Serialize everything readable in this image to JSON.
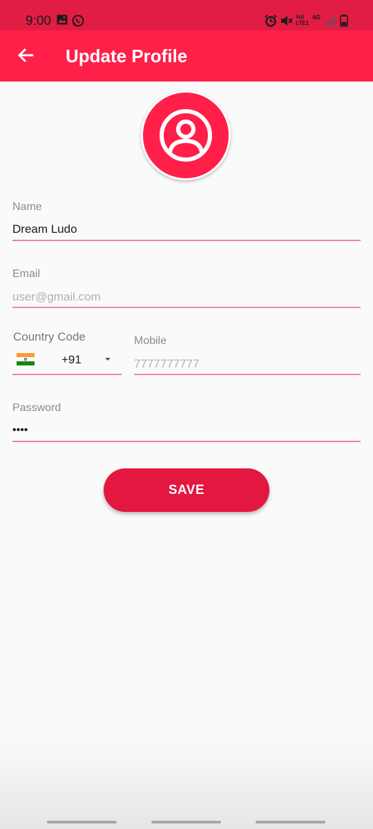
{
  "status_bar": {
    "time": "9:00",
    "icons": [
      "gallery-icon",
      "whatsapp-icon",
      "alarm-icon",
      "mute-icon",
      "volte-icon",
      "4g-icon",
      "signal-icon",
      "battery-icon"
    ],
    "volte_label": "Vo) LTE1",
    "network_label": "4G"
  },
  "app_bar": {
    "title": "Update Profile",
    "back_icon": "arrow-left-icon"
  },
  "avatar": {
    "icon": "user-circle-icon"
  },
  "form": {
    "name": {
      "label": "Name",
      "value": "Dream Ludo"
    },
    "email": {
      "label": "Email",
      "placeholder": "user@gmail.com"
    },
    "country_code": {
      "label": "Country Code",
      "value": "+91",
      "flag": "india-flag-icon"
    },
    "mobile": {
      "label": "Mobile",
      "placeholder": "7777777777"
    },
    "password": {
      "label": "Password",
      "value": "••••"
    }
  },
  "save_label": "SAVE",
  "colors": {
    "status_bar": "#e11d44",
    "app_bar": "#ff2049",
    "accent": "#e3173f",
    "underline": "#f08496"
  }
}
